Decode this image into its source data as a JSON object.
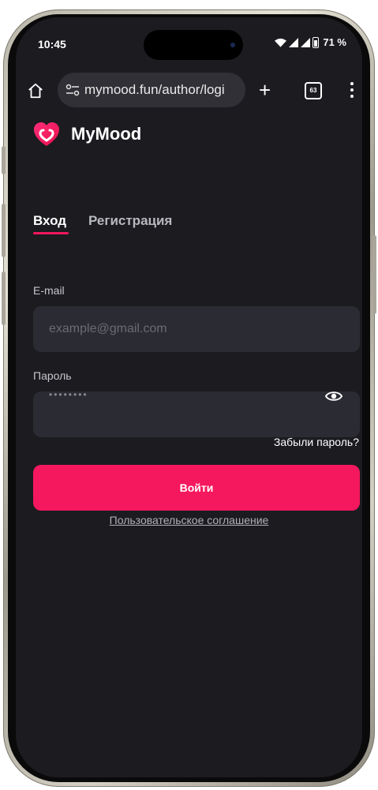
{
  "status_bar": {
    "time": "10:45",
    "battery": "71 %",
    "icons": [
      "wifi-icon",
      "signal-icon",
      "signal-icon",
      "battery-icon"
    ]
  },
  "browser": {
    "url": "mymood.fun/author/logi",
    "tab_count": "63",
    "icons": [
      "home-icon",
      "tune-icon",
      "plus-icon",
      "tabs-icon",
      "more-vert-icon"
    ]
  },
  "app": {
    "brand": "MyMood",
    "tabs": [
      {
        "label": "Вход",
        "active": true
      },
      {
        "label": "Регистрация",
        "active": false
      }
    ],
    "email": {
      "label": "E-mail",
      "placeholder": "example@gmail.com",
      "value": ""
    },
    "password": {
      "label": "Пароль",
      "masked_value": "••••••••"
    },
    "forgot_link": "Забыли пароль?",
    "submit_label": "Войти",
    "agreement_link": "Пользовательское соглашение"
  },
  "colors": {
    "accent": "#f5185f",
    "background": "#1c1b20",
    "field": "#2b2b33"
  }
}
